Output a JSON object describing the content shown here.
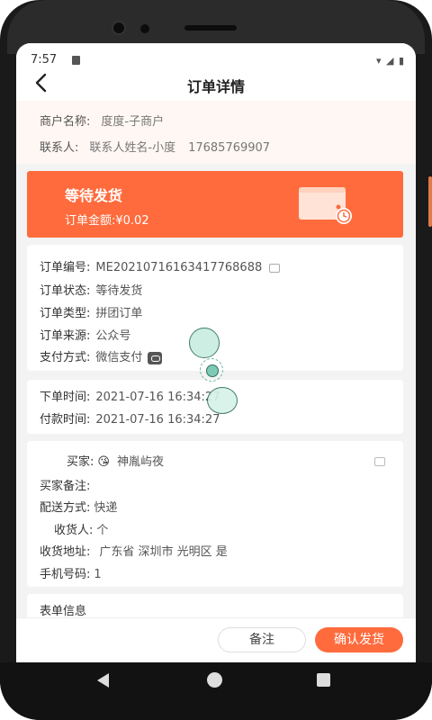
{
  "status_bar": {
    "time": "7:57"
  },
  "header": {
    "title": "订单详情"
  },
  "merchant": {
    "name_label": "商户名称:",
    "name_value": "度度-子商户",
    "contact_label": "联系人:",
    "contact_name": "联系人姓名-小度",
    "contact_phone": "17685769907"
  },
  "status_card": {
    "title": "等待发货",
    "amount": "订单金额:¥0.02",
    "accent_color": "#ff6b3d"
  },
  "order_info": {
    "number_label": "订单编号:",
    "number_value": "ME20210716163417768688",
    "status_label": "订单状态:",
    "status_value": "等待发货",
    "type_label": "订单类型:",
    "type_value": "拼团订单",
    "source_label": "订单来源:",
    "source_value": "公众号",
    "payment_label": "支付方式:",
    "payment_value": "微信支付"
  },
  "times": {
    "order_label": "下单时间:",
    "order_value": "2021-07-16 16:34:27",
    "pay_label": "付款时间:",
    "pay_value": "2021-07-16 16:34:27"
  },
  "buyer": {
    "buyer_label": "买家:",
    "buyer_emoji": "😘",
    "buyer_name": "神胤屿夜",
    "note_label": "买家备注:",
    "note_value": "",
    "delivery_label": "配送方式:",
    "delivery_value": "快递",
    "receiver_label": "收货人:",
    "receiver_value": "个",
    "address_label": "收货地址:",
    "address_value": "广东省 深圳市 光明区 是",
    "phone_label": "手机号码:",
    "phone_value": "1"
  },
  "form_info": {
    "title": "表单信息"
  },
  "actions": {
    "note_button": "备注",
    "confirm_button": "确认发货"
  }
}
